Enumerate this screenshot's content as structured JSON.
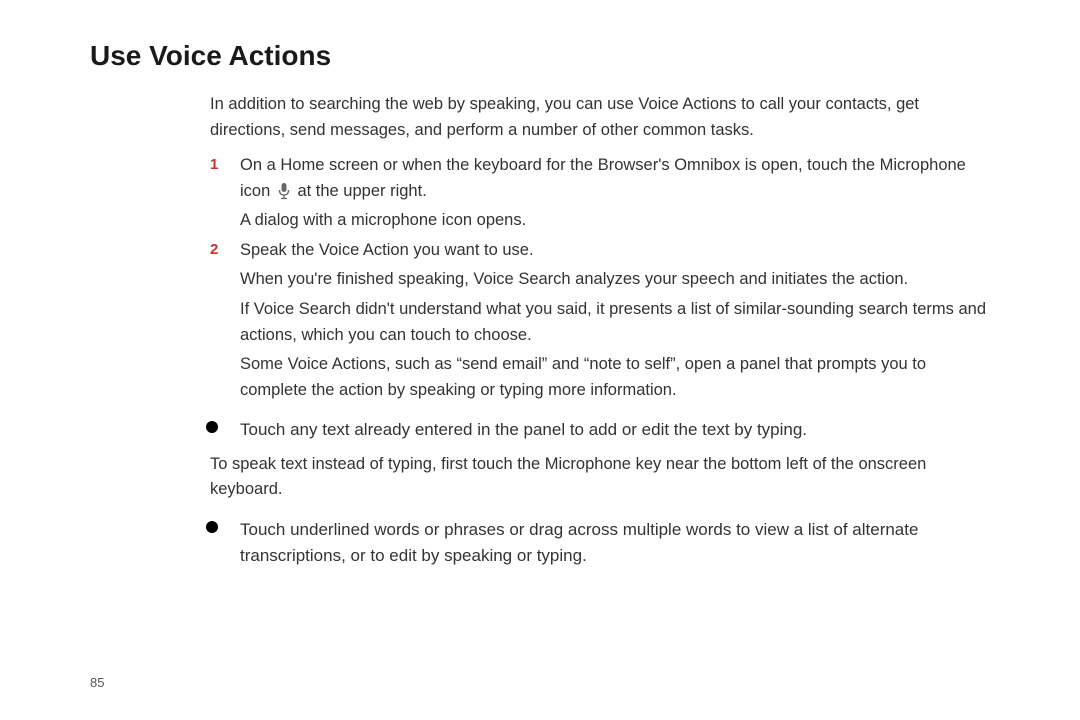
{
  "title": "Use Voice Actions",
  "intro": "In addition to searching the web by speaking, you can use Voice Actions to call your contacts, get directions, send messages, and perform a number of other common tasks.",
  "step1": {
    "num": "1",
    "text_before_icon": "On a Home screen or when the keyboard for the Browser's Omnibox is open, touch the Microphone icon ",
    "text_after_icon": " at the upper right.",
    "result": "A dialog with a microphone icon opens."
  },
  "step2": {
    "num": "2",
    "text": "Speak the Voice Action you want to use.",
    "result1": "When you're finished speaking, Voice Search analyzes your speech and initiates the action.",
    "result2": "If Voice Search didn't understand what you said, it presents a list of similar-sounding search terms and actions, which you can touch to choose.",
    "result3": "Some Voice Actions, such as “send email” and “note to self”, open a panel that prompts you to complete the action by speaking or typing more information."
  },
  "bullet1": "Touch any text already entered in the panel to add or edit the text by typing.",
  "plain1": "To speak text instead of typing, first touch the Microphone key near the bottom left of the onscreen keyboard.",
  "bullet2": "Touch underlined words or phrases or drag across multiple words to view a list of alternate transcriptions, or to edit by speaking or typing.",
  "page_number": "85"
}
